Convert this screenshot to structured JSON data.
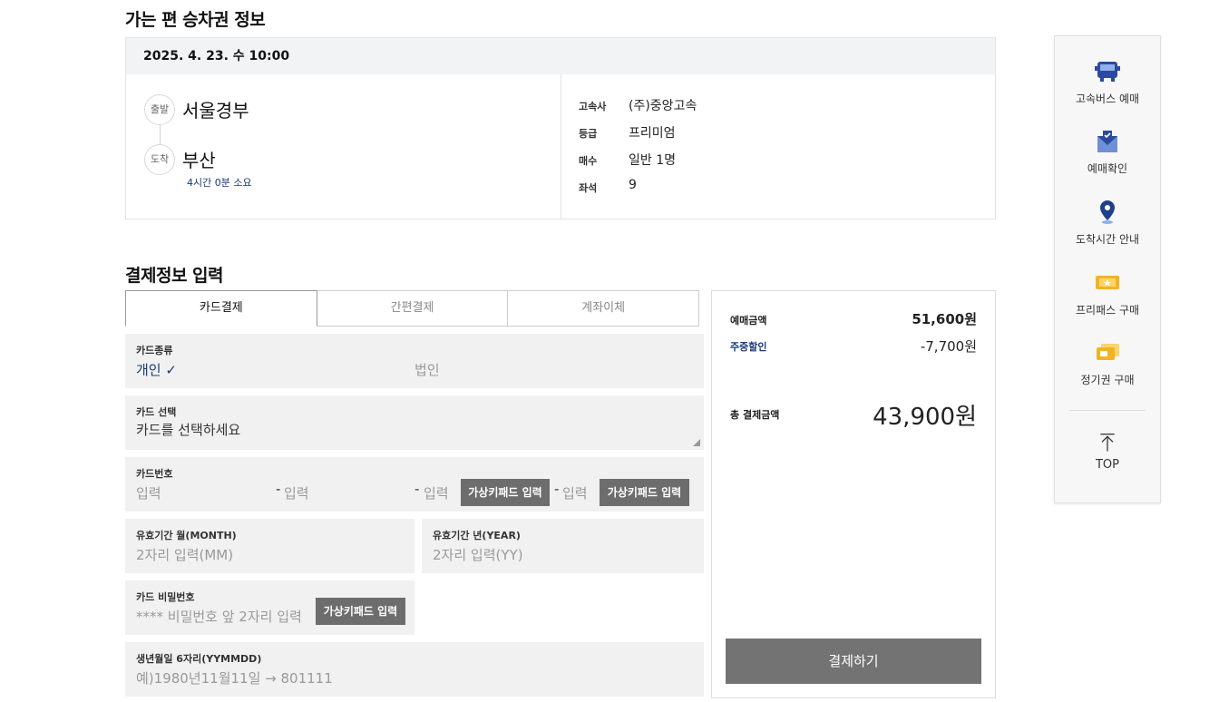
{
  "outbound": {
    "section_title": "가는 편 승차권 정보",
    "date": "2025. 4. 23. 수 10:00",
    "depart_badge": "출발",
    "depart_name": "서울경부",
    "arrive_badge": "도착",
    "arrive_name": "부산",
    "duration": "4시간 0분 소요",
    "info": [
      {
        "label": "고속사",
        "value": "(주)중앙고속"
      },
      {
        "label": "등급",
        "value": "프리미엄"
      },
      {
        "label": "매수",
        "value": "일반 1명"
      },
      {
        "label": "좌석",
        "value": "9"
      }
    ]
  },
  "payment": {
    "section_title": "결제정보 입력",
    "tabs": [
      "카드결제",
      "간편결제",
      "계좌이체"
    ],
    "card_type": {
      "label": "카드종류",
      "personal": "개인",
      "check": "✓",
      "corporate": "법인"
    },
    "card_select": {
      "label": "카드 선택",
      "value": "카드를 선택하세요"
    },
    "card_number": {
      "label": "카드번호",
      "placeholder": "입력",
      "dash": "-",
      "keypad_label": "가상키패드 입력"
    },
    "expiry_month": {
      "label": "유효기간 월(MONTH)",
      "placeholder": "2자리 입력(MM)"
    },
    "expiry_year": {
      "label": "유효기간 년(YEAR)",
      "placeholder": "2자리 입력(YY)"
    },
    "card_pw": {
      "label": "카드 비밀번호",
      "placeholder": "**** 비밀번호 앞 2자리 입력",
      "keypad_label": "가상키패드 입력"
    },
    "birth": {
      "label": "생년월일 6자리(YYMMDD)",
      "placeholder": "예)1980년11월11일 → 801111"
    }
  },
  "summary": {
    "amount_label": "예매금액",
    "amount_value": "51,600원",
    "discount_label": "주중할인",
    "discount_value": "-7,700원",
    "total_label": "총 결제금액",
    "total_value": "43,900원",
    "pay_button": "결제하기",
    "colors": {
      "discount": "#1a3a7a",
      "button": "#737373"
    }
  },
  "quick_menu": {
    "items": [
      {
        "label": "고속버스 예매",
        "icon": "bus-icon"
      },
      {
        "label": "예매확인",
        "icon": "envelope-check-icon"
      },
      {
        "label": "도착시간 안내",
        "icon": "location-pin-icon"
      },
      {
        "label": "프리패스 구매",
        "icon": "ticket-star-icon"
      },
      {
        "label": "정기권 구매",
        "icon": "ticket-pass-icon"
      }
    ],
    "top_label": "TOP"
  }
}
